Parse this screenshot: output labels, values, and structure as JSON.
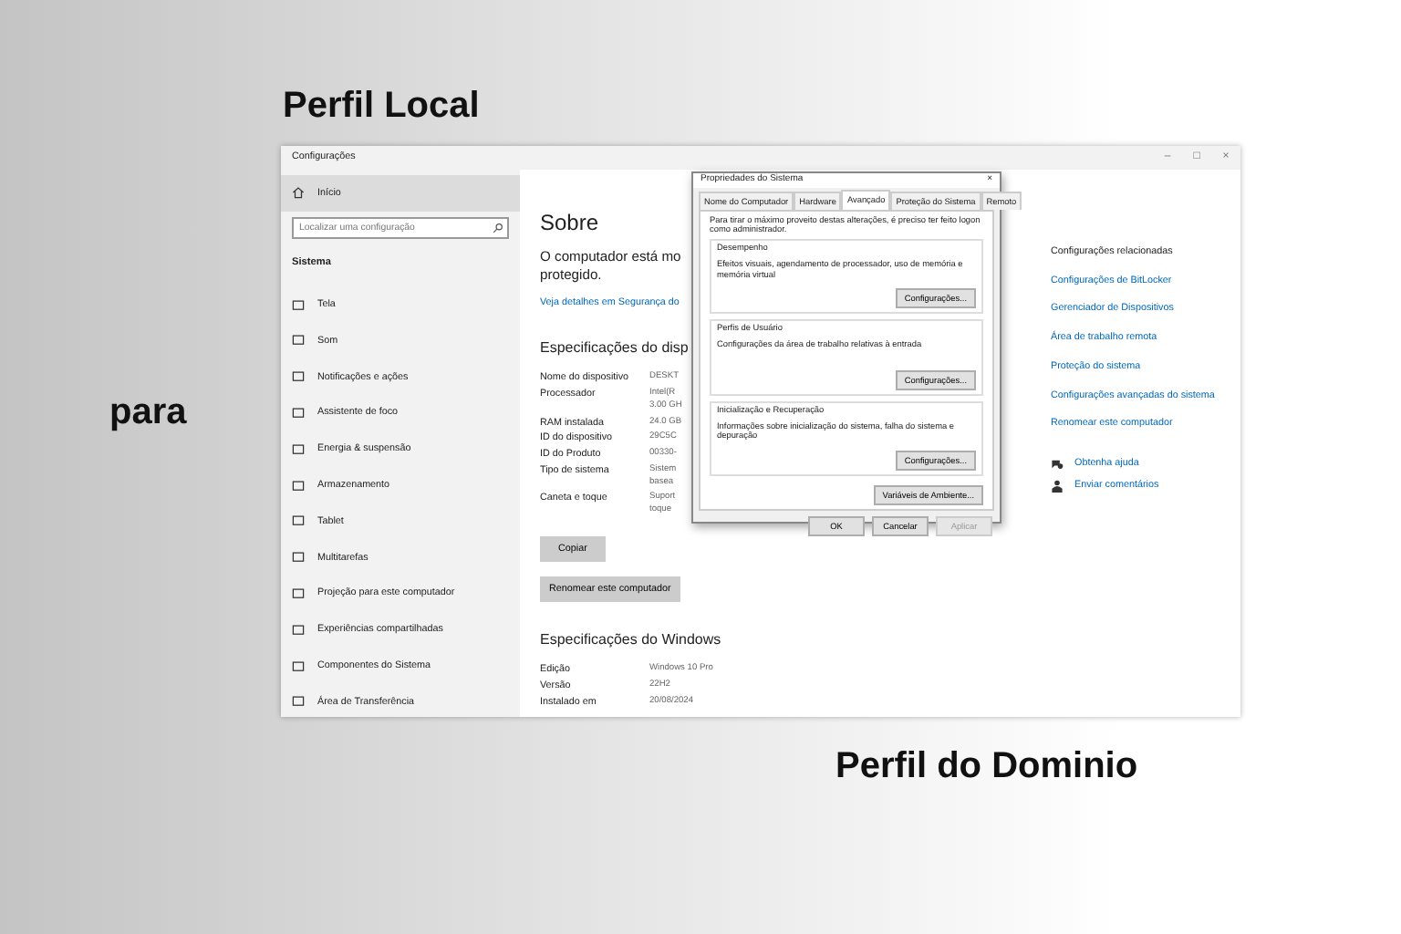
{
  "captions": {
    "top": "Perfil Local",
    "left": "para",
    "bottom": "Perfil do Dominio"
  },
  "window": {
    "title": "Configurações",
    "controls": [
      "–",
      "□",
      "×"
    ]
  },
  "sidebar": {
    "home": {
      "label": "Início",
      "selected": true
    },
    "search": {
      "placeholder": "Localizar uma configuração"
    },
    "heading": "Sistema",
    "items": [
      {
        "label": "Tela",
        "selected": false
      },
      {
        "label": "Som",
        "selected": false
      },
      {
        "label": "Notificações e ações",
        "selected": false
      },
      {
        "label": "Assistente de foco",
        "selected": false
      },
      {
        "label": "Energia & suspensão",
        "selected": false
      },
      {
        "label": "Armazenamento",
        "selected": false
      },
      {
        "label": "Tablet",
        "selected": false
      },
      {
        "label": "Multitarefas",
        "selected": false
      },
      {
        "label": "Projeção para este computador",
        "selected": false
      },
      {
        "label": "Experiências compartilhadas",
        "selected": false
      },
      {
        "label": "Componentes do Sistema",
        "selected": false
      },
      {
        "label": "Área de Transferência",
        "selected": false
      }
    ]
  },
  "main": {
    "title": "Sobre",
    "message": "O computador está mo\nprotegido.",
    "link": "Veja detalhes em Segurança do",
    "device_heading": "Especificações do disp",
    "device_specs": [
      {
        "label": "Nome do dispositivo",
        "value": "DESKT"
      },
      {
        "label": "Processador",
        "value": "Intel(R\n3.00 GH"
      },
      {
        "label": "RAM instalada",
        "value": "24.0 GB"
      },
      {
        "label": "ID do dispositivo",
        "value": "29C5C"
      },
      {
        "label": "ID do Produto",
        "value": "00330-"
      },
      {
        "label": "Tipo de sistema",
        "value": "Sistem\nbasea"
      },
      {
        "label": "Caneta e toque",
        "value": "Suport\ntoque"
      }
    ],
    "copy_button": "Copiar",
    "rename_button": "Renomear este computador",
    "windows_heading": "Especificações do Windows",
    "windows_specs": [
      {
        "label": "Edição",
        "value": "Windows 10 Pro"
      },
      {
        "label": "Versão",
        "value": "22H2"
      },
      {
        "label": "Instalado em",
        "value": "20/08/2024"
      }
    ]
  },
  "related": {
    "heading": "Configurações relacionadas",
    "links": [
      "Configurações de BitLocker",
      "Gerenciador de Dispositivos",
      "Área de trabalho remota",
      "Proteção do sistema",
      "Configurações avançadas do sistema",
      "Renomear este computador"
    ],
    "help": [
      {
        "kind": "help",
        "label": "Obtenha ajuda"
      },
      {
        "kind": "feedback",
        "label": "Enviar comentários"
      }
    ]
  },
  "dialog": {
    "title": "Propriedades do Sistema",
    "close": "×",
    "tabs": [
      {
        "label": "Nome do Computador",
        "selected": false
      },
      {
        "label": "Hardware",
        "selected": false
      },
      {
        "label": "Avançado",
        "selected": true
      },
      {
        "label": "Proteção do Sistema",
        "selected": false
      },
      {
        "label": "Remoto",
        "selected": false
      }
    ],
    "intro": "Para tirar o máximo proveito destas alterações, é preciso ter feito logon como administrador.",
    "groups": [
      {
        "title": "Desempenho",
        "text": "Efeitos visuais, agendamento de processador, uso de memória e memória virtual",
        "button": "Configurações..."
      },
      {
        "title": "Perfis de Usuário",
        "text": "Configurações da área de trabalho relativas à entrada",
        "button": "Configurações..."
      },
      {
        "title": "Inicialização e Recuperação",
        "text": "Informações sobre inicialização do sistema, falha do sistema e depuração",
        "button": "Configurações..."
      }
    ],
    "env_button": "Variáveis de Ambiente...",
    "buttons": [
      {
        "label": "OK",
        "disabled": false
      },
      {
        "label": "Cancelar",
        "disabled": false
      },
      {
        "label": "Aplicar",
        "disabled": true
      }
    ]
  }
}
